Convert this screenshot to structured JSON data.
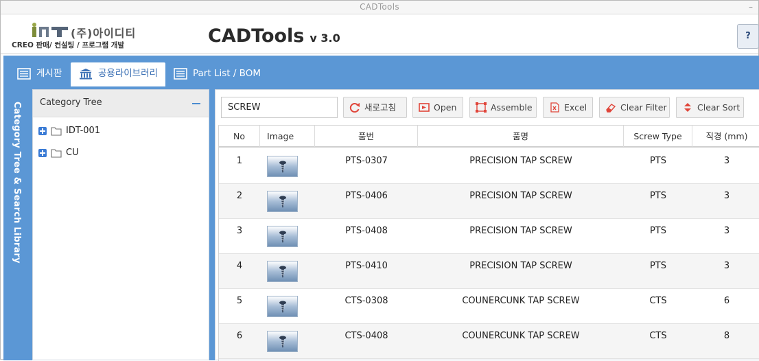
{
  "window": {
    "title": "CADTools",
    "minimize_glyph": "–"
  },
  "header": {
    "company": "(주)아이디티",
    "tagline": "CREO 판매/ 컨설팅 / 프로그램 개발",
    "app_title": "CADTools",
    "version": "v 3.0",
    "help_label": "?"
  },
  "tabs": [
    {
      "label": "게시판",
      "icon": "board-icon"
    },
    {
      "label": "공용라이브러리",
      "icon": "library-icon",
      "active": true
    },
    {
      "label": "Part List / BOM",
      "icon": "list-icon"
    }
  ],
  "sidebar": {
    "rail_label": "Category Tree & Search Library"
  },
  "tree": {
    "title": "Category Tree",
    "items": [
      {
        "name": "IDT-001"
      },
      {
        "name": "CU"
      }
    ]
  },
  "toolbar": {
    "search_value": "SCREW",
    "refresh": "새로고침",
    "open": "Open",
    "assemble": "Assemble",
    "excel": "Excel",
    "clear_filter": "Clear Filter",
    "clear_sort": "Clear Sort"
  },
  "table": {
    "columns": [
      "No",
      "Image",
      "품번",
      "품명",
      "Screw Type",
      "직경 (mm)"
    ],
    "rows": [
      {
        "no": "1",
        "part_no": "PTS-0307",
        "name": "PRECISION TAP SCREW",
        "type": "PTS",
        "dia": "3"
      },
      {
        "no": "2",
        "part_no": "PTS-0406",
        "name": "PRECISION TAP SCREW",
        "type": "PTS",
        "dia": "3"
      },
      {
        "no": "3",
        "part_no": "PTS-0408",
        "name": "PRECISION TAP SCREW",
        "type": "PTS",
        "dia": "3"
      },
      {
        "no": "4",
        "part_no": "PTS-0410",
        "name": "PRECISION TAP SCREW",
        "type": "PTS",
        "dia": "3"
      },
      {
        "no": "5",
        "part_no": "CTS-0308",
        "name": "COUNERCUNK TAP SCREW",
        "type": "CTS",
        "dia": "6"
      },
      {
        "no": "6",
        "part_no": "CTS-0408",
        "name": "COUNERCUNK TAP SCREW",
        "type": "CTS",
        "dia": "8"
      }
    ]
  },
  "colors": {
    "accent": "#5b97d5",
    "tab_active_text": "#3a6fb4",
    "refresh_icon": "#e0453a"
  }
}
